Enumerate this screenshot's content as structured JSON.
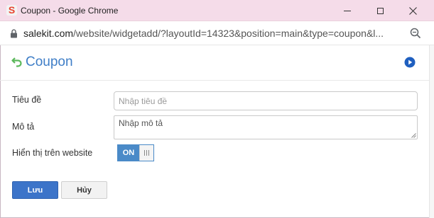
{
  "window": {
    "title": "Coupon - Google Chrome",
    "logo_letter": "S"
  },
  "address_bar": {
    "host": "salekit.com",
    "path": "/website/widgetadd/?layoutId=14323&position=main&type=coupon&l..."
  },
  "page": {
    "title": "Coupon"
  },
  "form": {
    "title_label": "Tiêu đề",
    "title_placeholder": "Nhập tiêu đề",
    "title_value": "",
    "desc_label": "Mô tả",
    "desc_placeholder": "Nhập mô tả",
    "desc_value": "",
    "show_label": "Hiển thị trên website",
    "toggle_label": "ON",
    "toggle_state": true
  },
  "buttons": {
    "save_label": "Lưu",
    "cancel_label": "Hủy"
  },
  "colors": {
    "titlebar": "#f5dce9",
    "accent": "#3f7ec7",
    "primary_button": "#3c74c9",
    "toggle_on": "#4a8ac8",
    "back_icon": "#5cb85c"
  },
  "icons": {
    "app_logo": "salekit-logo-icon",
    "lock": "lock-icon",
    "zoom": "zoom-icon",
    "back": "undo-arrow-icon",
    "play": "play-circle-icon",
    "minimize": "minimize-icon",
    "maximize": "maximize-icon",
    "close": "close-icon"
  }
}
